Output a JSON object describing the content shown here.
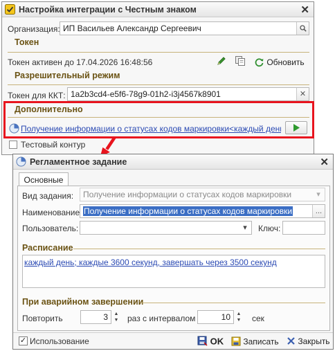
{
  "main_window": {
    "title": "Настройка интеграции с Честным знаком",
    "org_label": "Организация:",
    "org_value": "ИП Васильев Александр Сергеевич",
    "token_section": "Токен",
    "token_status": "Токен активен до 17.04.2026 16:48:56",
    "refresh_label": "Обновить",
    "permissive_section": "Разрешительный режим",
    "kkt_token_label": "Токен для ККТ:",
    "kkt_token_value": "1a2b3cd4-e5f6-78g9-01h2-i3j4567k8901",
    "extra_section": "Дополнительно",
    "job_link": "Получение информации о статусах кодов маркировки<каждый день; ка...",
    "test_contour_label": "Тестовый контур",
    "test_contour_checked": false
  },
  "job_window": {
    "title": "Регламентное задание",
    "tab_main": "Основные",
    "job_type_label": "Вид задания:",
    "job_type_value": "Получение информации о статусах кодов маркировки",
    "name_label": "Наименование:",
    "name_value": "Получение информации о статусах кодов маркировки",
    "user_label": "Пользователь:",
    "user_value": "",
    "key_label": "Ключ:",
    "key_value": "",
    "schedule_section": "Расписание",
    "schedule_link": "каждый день; каждые 3600 секунд, завершать через 3500 секунд",
    "crash_section": "При аварийном завершении",
    "repeat_label": "Повторить",
    "repeat_value": "3",
    "interval_label": "раз с интервалом",
    "interval_value": "10",
    "sec_label": "сек",
    "usage_label": "Использование",
    "usage_checked": true,
    "ok_label": "OK",
    "save_label": "Записать",
    "close_label": "Закрыть"
  },
  "colors": {
    "highlight": "#e8141e",
    "section_title": "#6b5314",
    "link": "#2b4ab3",
    "run_green": "#2e9a2e"
  }
}
